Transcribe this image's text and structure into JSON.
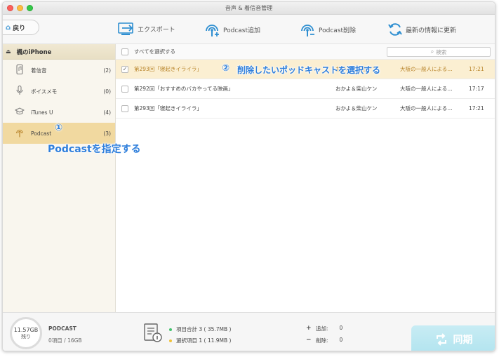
{
  "window": {
    "title": "音声 & 着信音管理"
  },
  "toolbar": {
    "back_label": "戻り",
    "export_label": "エクスポート",
    "add_label": "Podcast追加",
    "delete_label": "Podcast削除",
    "refresh_label": "最新の情報に更新"
  },
  "sidebar": {
    "device_name": "楓のiPhone",
    "items": [
      {
        "label": "着信音",
        "count": "(2)",
        "icon": "phone-icon"
      },
      {
        "label": "ボイスメモ",
        "count": "(0)",
        "icon": "microphone-icon"
      },
      {
        "label": "iTunes U",
        "count": "(4)",
        "icon": "graduation-cap-icon"
      },
      {
        "label": "Podcast",
        "count": "(3)",
        "icon": "podcast-icon"
      }
    ]
  },
  "list": {
    "select_all_label": "すべてを選択する",
    "search_placeholder": "検索",
    "rows": [
      {
        "title": "第293回「寝起きイライラ」",
        "artist": "おかよ＆柴山ケン",
        "album": "大阪の一般人による…",
        "duration": "17:21",
        "checked": true
      },
      {
        "title": "第292回「おすすめのバカやってる映画」",
        "artist": "おかよ＆柴山ケン",
        "album": "大阪の一般人による…",
        "duration": "17:17",
        "checked": false
      },
      {
        "title": "第293回「寝起きイライラ」",
        "artist": "おかよ＆柴山ケン",
        "album": "大阪の一般人による…",
        "duration": "17:21",
        "checked": false
      }
    ]
  },
  "footer": {
    "storage_value": "11.57GB",
    "storage_label": "残り",
    "device_label": "PODCAST",
    "device_info": "0項目 / 16GB",
    "total_label": "項目合計 3 ( 35.7MB )",
    "selected_label": "選択項目 1 ( 11.9MB )",
    "add_text": "追加:",
    "add_count": "0",
    "delete_text": "削除:",
    "delete_count": "0",
    "sync_label": "同期"
  },
  "annotations": {
    "step1_num": "①",
    "step1_text": "Podcastを指定する",
    "step2_num": "②",
    "step2_text": "削除したいポッドキャストを選択する"
  },
  "colors": {
    "accent_orange": "#b8842a",
    "selected_bg": "#fbefd2",
    "sidebar_active": "#f1d9a0",
    "toolbar_icon": "#2f8fd1",
    "annotation_blue": "#2f7fdc",
    "sync_button": "#b2e4ef"
  }
}
